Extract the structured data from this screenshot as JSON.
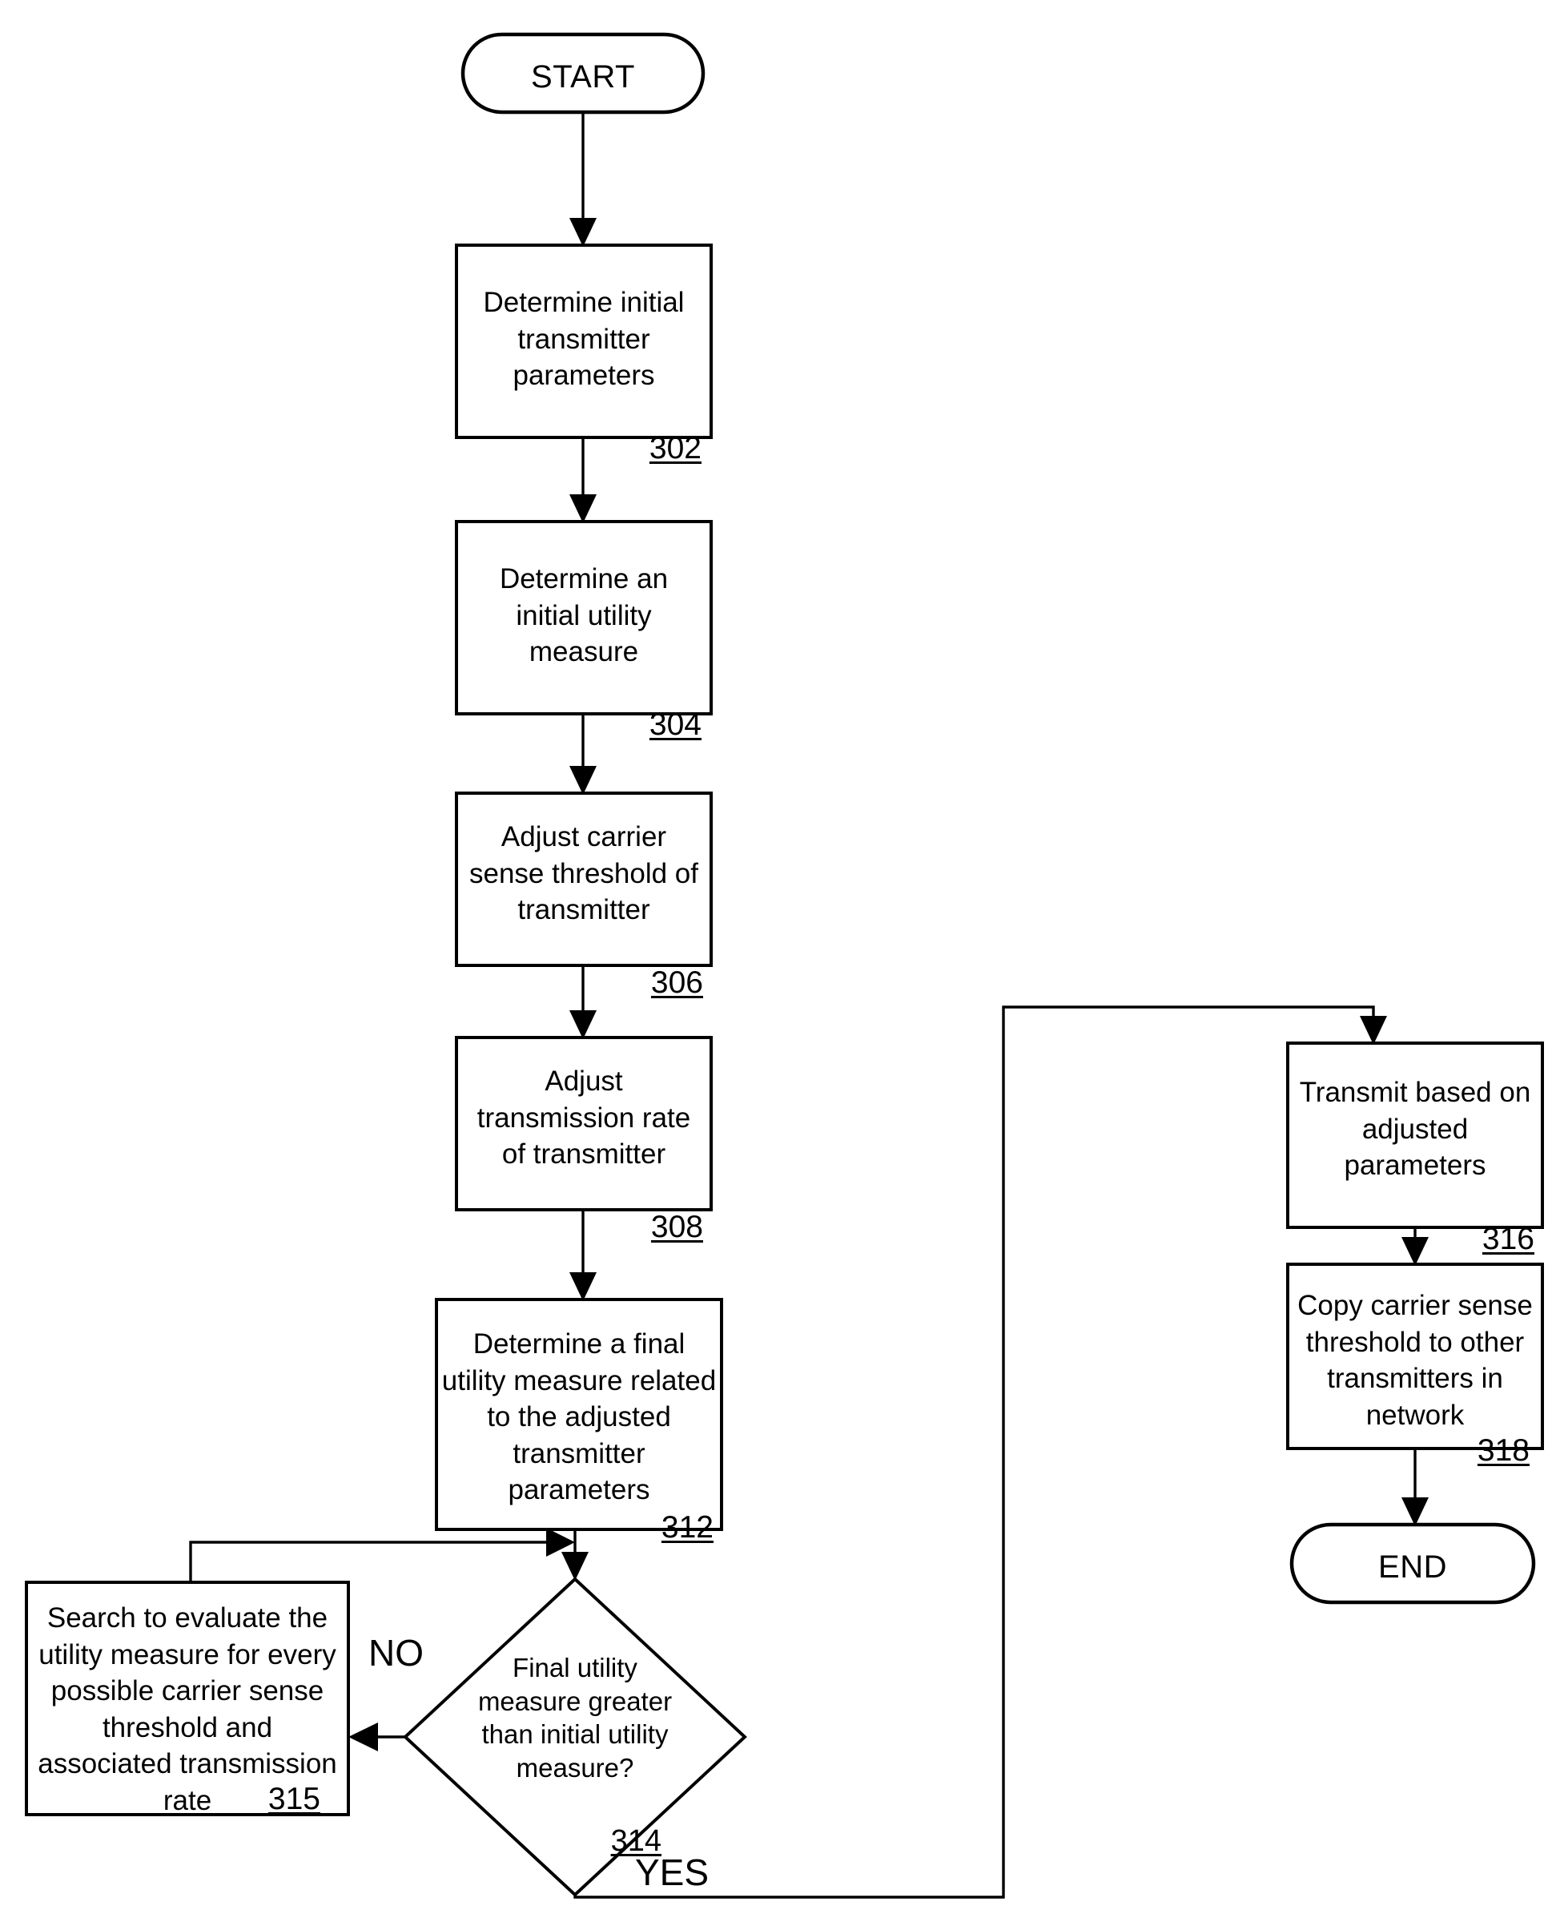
{
  "figure": {
    "type": "flowchart",
    "orientation": "top-to-bottom, two columns"
  },
  "nodes": {
    "start": {
      "shape": "terminator",
      "label": "START"
    },
    "n302": {
      "shape": "process",
      "text": "Determine initial\ntransmitter\nparameters",
      "ref": "302"
    },
    "n304": {
      "shape": "process",
      "text": "Determine an\ninitial utility\nmeasure",
      "ref": "304"
    },
    "n306": {
      "shape": "process",
      "text": "Adjust carrier\nsense threshold of\ntransmitter",
      "ref": "306"
    },
    "n308": {
      "shape": "process",
      "text": "Adjust\ntransmission rate\nof transmitter",
      "ref": "308"
    },
    "n312": {
      "shape": "process",
      "text": "Determine a final\nutility measure related\nto the adjusted\ntransmitter\nparameters",
      "ref": "312"
    },
    "n314": {
      "shape": "decision",
      "text": "Final utility\nmeasure greater\nthan initial utility\nmeasure?",
      "ref": "314"
    },
    "n315": {
      "shape": "process",
      "text": "Search to evaluate the\nutility measure for every\npossible carrier sense\nthreshold and\nassociated transmission\nrate",
      "ref": "315"
    },
    "n316": {
      "shape": "process",
      "text": "Transmit based on\nadjusted\nparameters",
      "ref": "316"
    },
    "n318": {
      "shape": "process",
      "text": "Copy carrier sense\nthreshold to other\ntransmitters in\nnetwork",
      "ref": "318"
    },
    "end": {
      "shape": "terminator",
      "label": "END"
    }
  },
  "edge_labels": {
    "no": "NO",
    "yes": "YES"
  },
  "colors": {
    "stroke": "#000000",
    "fill": "#ffffff",
    "text": "#000000"
  }
}
